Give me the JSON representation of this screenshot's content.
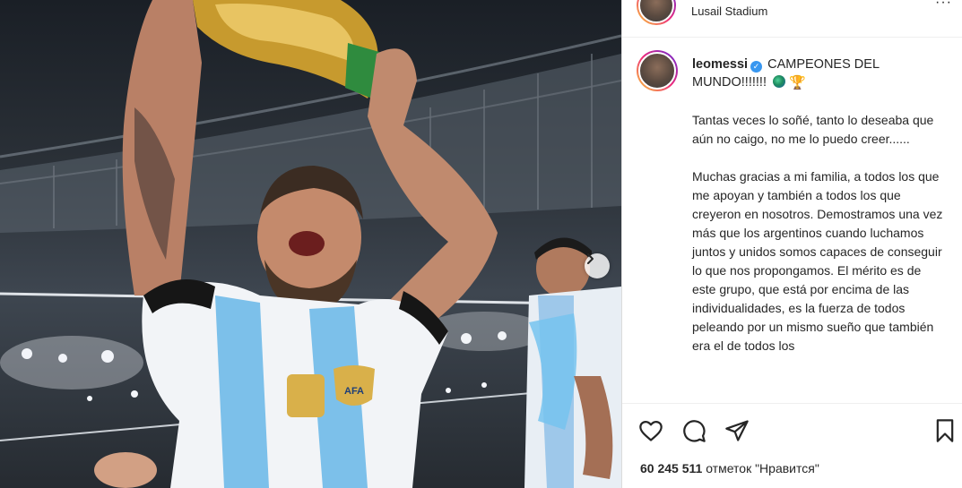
{
  "post": {
    "location": "Lusail Stadium",
    "username": "leomessi",
    "caption_title": "CAMPEONES DEL MUNDO!!!!!!!",
    "caption_paragraphs": [
      "Tantas veces lo soñé, tanto lo deseaba que aún no caigo, no me lo puedo creer......",
      "Muchas gracias a mi familia, a todos los que me apoyan y también a todos los que creyeron en nosotros. Demostramos una vez más que los argentinos cuando luchamos juntos y unidos somos capaces de conseguir lo que nos propongamos. El mérito es de este grupo, que está por encima de las individualidades, es la fuerza de todos peleando por un mismo sueño que también era el de todos los"
    ],
    "likes_count": "60 245 511",
    "likes_label": "отметок \"Нравится\""
  },
  "icons": {
    "more": "more-options-icon",
    "verified": "verified-badge-icon",
    "globe": "globe-emoji-icon",
    "trophy": "trophy-emoji-icon",
    "next": "chevron-right-icon",
    "like": "heart-icon",
    "comment": "comment-icon",
    "share": "share-icon",
    "save": "bookmark-icon"
  },
  "colors": {
    "verified": "#3897f0",
    "text": "#262626",
    "border": "#dbdbdb"
  }
}
